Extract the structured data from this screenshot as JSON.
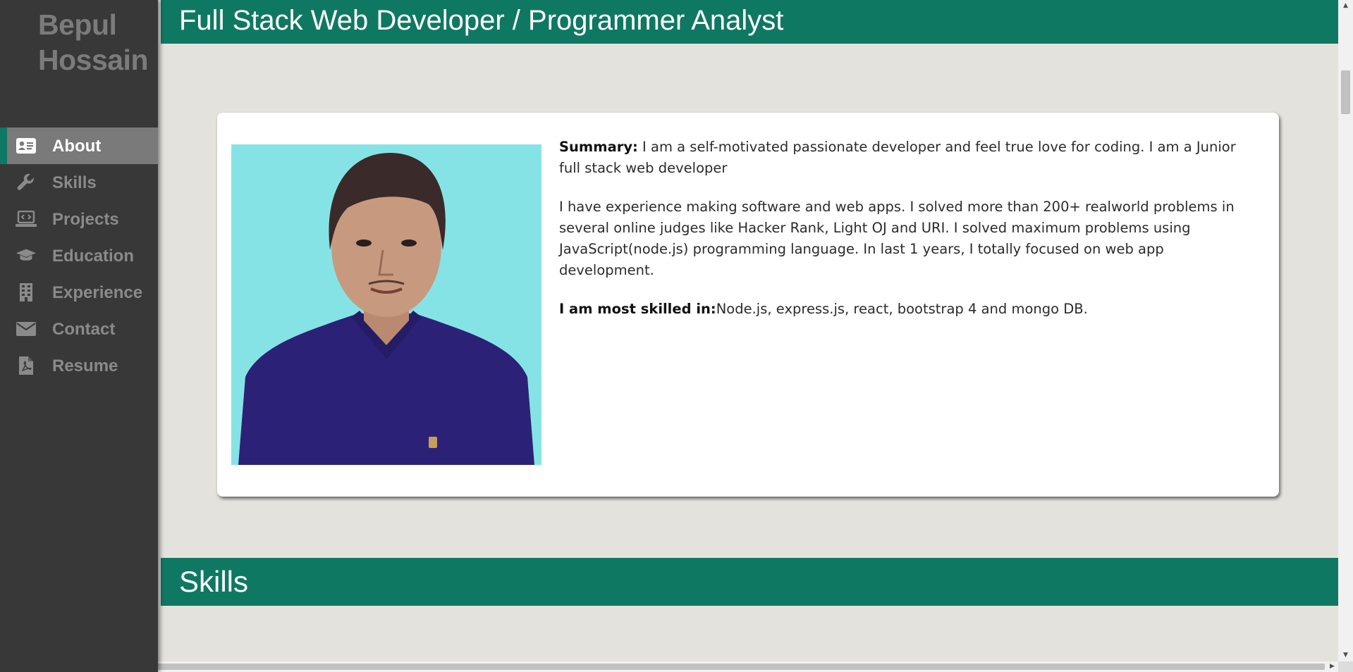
{
  "brand": {
    "line1": "Bepul",
    "line2": "Hossain"
  },
  "nav": [
    {
      "label": "About",
      "icon": "id-card-icon",
      "active": true
    },
    {
      "label": "Skills",
      "icon": "wrench-icon",
      "active": false
    },
    {
      "label": "Projects",
      "icon": "laptop-code-icon",
      "active": false
    },
    {
      "label": "Education",
      "icon": "graduation-cap-icon",
      "active": false
    },
    {
      "label": "Experience",
      "icon": "building-icon",
      "active": false
    },
    {
      "label": "Contact",
      "icon": "envelope-icon",
      "active": false
    },
    {
      "label": "Resume",
      "icon": "pdf-file-icon",
      "active": false
    }
  ],
  "about": {
    "heading": "Full Stack Web Developer / Programmer Analyst",
    "summary_label": "Summary:",
    "summary_text": " I am a self-motivated passionate developer and feel true love for coding. I am a Junior full stack web developer",
    "experience_text": "I have experience making software and web apps. I solved more than 200+ realworld problems in several online judges like Hacker Rank, Light OJ and URI. I solved maximum problems using JavaScript(node.js) programming language. In last 1 years, I totally focused on web app development.",
    "skilled_label": "I am most skilled in:",
    "skilled_text": "Node.js, express.js, react, bootstrap 4 and mongo DB."
  },
  "skills": {
    "heading": "Skills"
  },
  "colors": {
    "accent": "#0f7862",
    "sidebar": "#383838",
    "photo_bg": "#86e3e5"
  }
}
